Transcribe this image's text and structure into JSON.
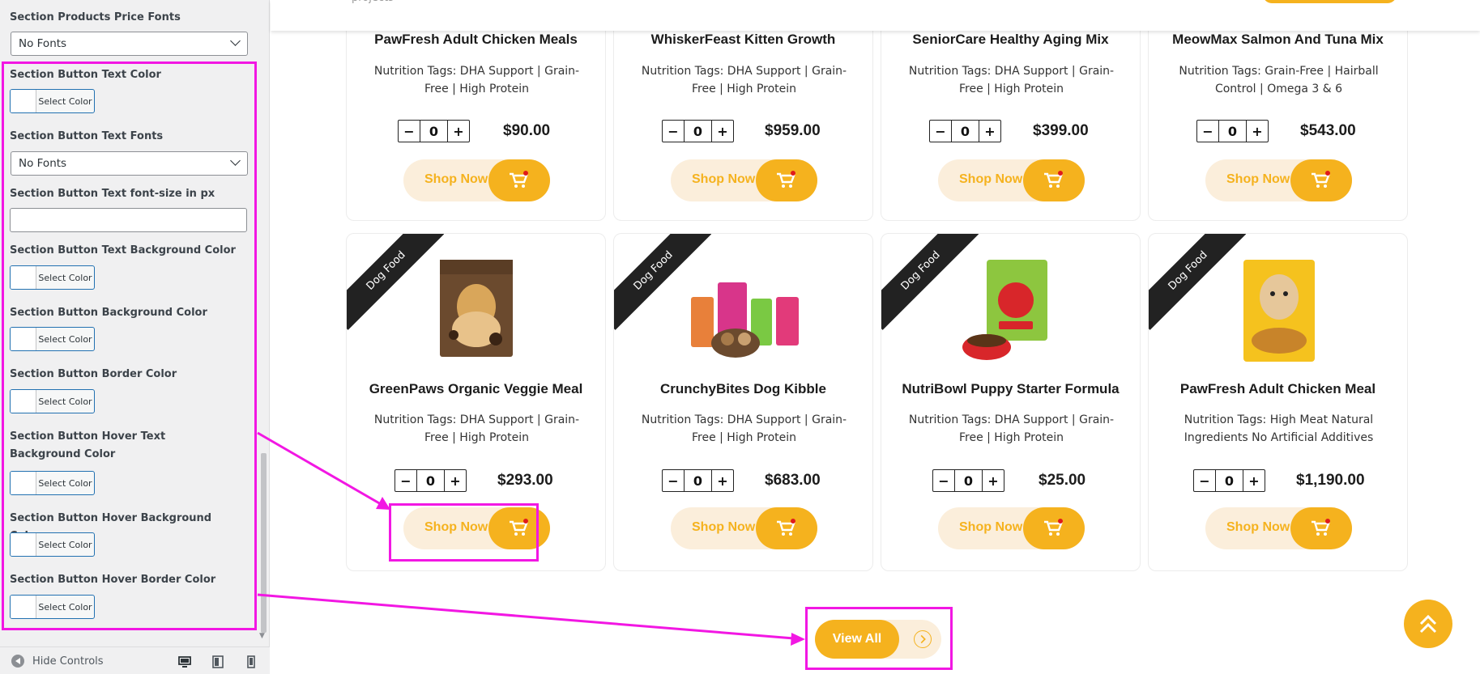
{
  "panel": {
    "price_fonts_label": "Section Products Price Fonts",
    "price_fonts_value": "No Fonts",
    "btn_text_color_label": "Section Button Text Color",
    "btn_text_fonts_label": "Section Button Text Fonts",
    "btn_text_fonts_value": "No Fonts",
    "btn_font_size_label": "Section Button Text font-size in px",
    "btn_text_bg_label": "Section Button Text Background Color",
    "btn_bg_label": "Section Button Background Color",
    "btn_border_label": "Section Button Border Color",
    "btn_hover_text_bg_label": "Section Button Hover Text Background Color",
    "btn_hover_bg_label": "Section Button Hover Background Color",
    "btn_hover_border_label": "Section Button Hover Border Color",
    "select_color": "Select Color",
    "hide_controls": "Hide Controls"
  },
  "header": {
    "partial_text": "projects"
  },
  "products_row1": [
    {
      "title": "PawFresh Adult Chicken Meals",
      "tags": "Nutrition Tags: DHA Support | Grain-Free | High Protein",
      "qty": "0",
      "price": "$90.00"
    },
    {
      "title": "WhiskerFeast Kitten Growth",
      "tags": "Nutrition Tags: DHA Support | Grain-Free | High Protein",
      "qty": "0",
      "price": "$959.00"
    },
    {
      "title": "SeniorCare Healthy Aging Mix",
      "tags": "Nutrition Tags: DHA Support | Grain-Free | High Protein",
      "qty": "0",
      "price": "$399.00"
    },
    {
      "title": "MeowMax Salmon And Tuna Mix",
      "tags": "Nutrition Tags: Grain-Free | Hairball Control | Omega 3 & 6",
      "qty": "0",
      "price": "$543.00"
    }
  ],
  "products_row2": [
    {
      "ribbon": "Dog Food",
      "title": "GreenPaws Organic Veggie Meal",
      "tags": "Nutrition Tags: DHA Support | Grain-Free | High Protein",
      "qty": "0",
      "price": "$293.00"
    },
    {
      "ribbon": "Dog Food",
      "title": "CrunchyBites Dog Kibble",
      "tags": "Nutrition Tags: DHA Support | Grain-Free | High Protein",
      "qty": "0",
      "price": "$683.00"
    },
    {
      "ribbon": "Dog Food",
      "title": "NutriBowl Puppy Starter Formula",
      "tags": "Nutrition Tags: DHA Support | Grain-Free | High Protein",
      "qty": "0",
      "price": "$25.00"
    },
    {
      "ribbon": "Dog Food",
      "title": "PawFresh Adult Chicken Meal",
      "tags": "Nutrition Tags: High Meat Natural Ingredients No Artificial Additives",
      "qty": "0",
      "price": "$1,190.00"
    }
  ],
  "qty_controls": {
    "minus": "−",
    "plus": "+"
  },
  "shop_now": "Shop Now",
  "view_all": "View All",
  "colors": {
    "accent": "#f5b21e",
    "accent_light": "#fbeedb",
    "annotation": "#f217e3",
    "ribbon": "#222222"
  }
}
